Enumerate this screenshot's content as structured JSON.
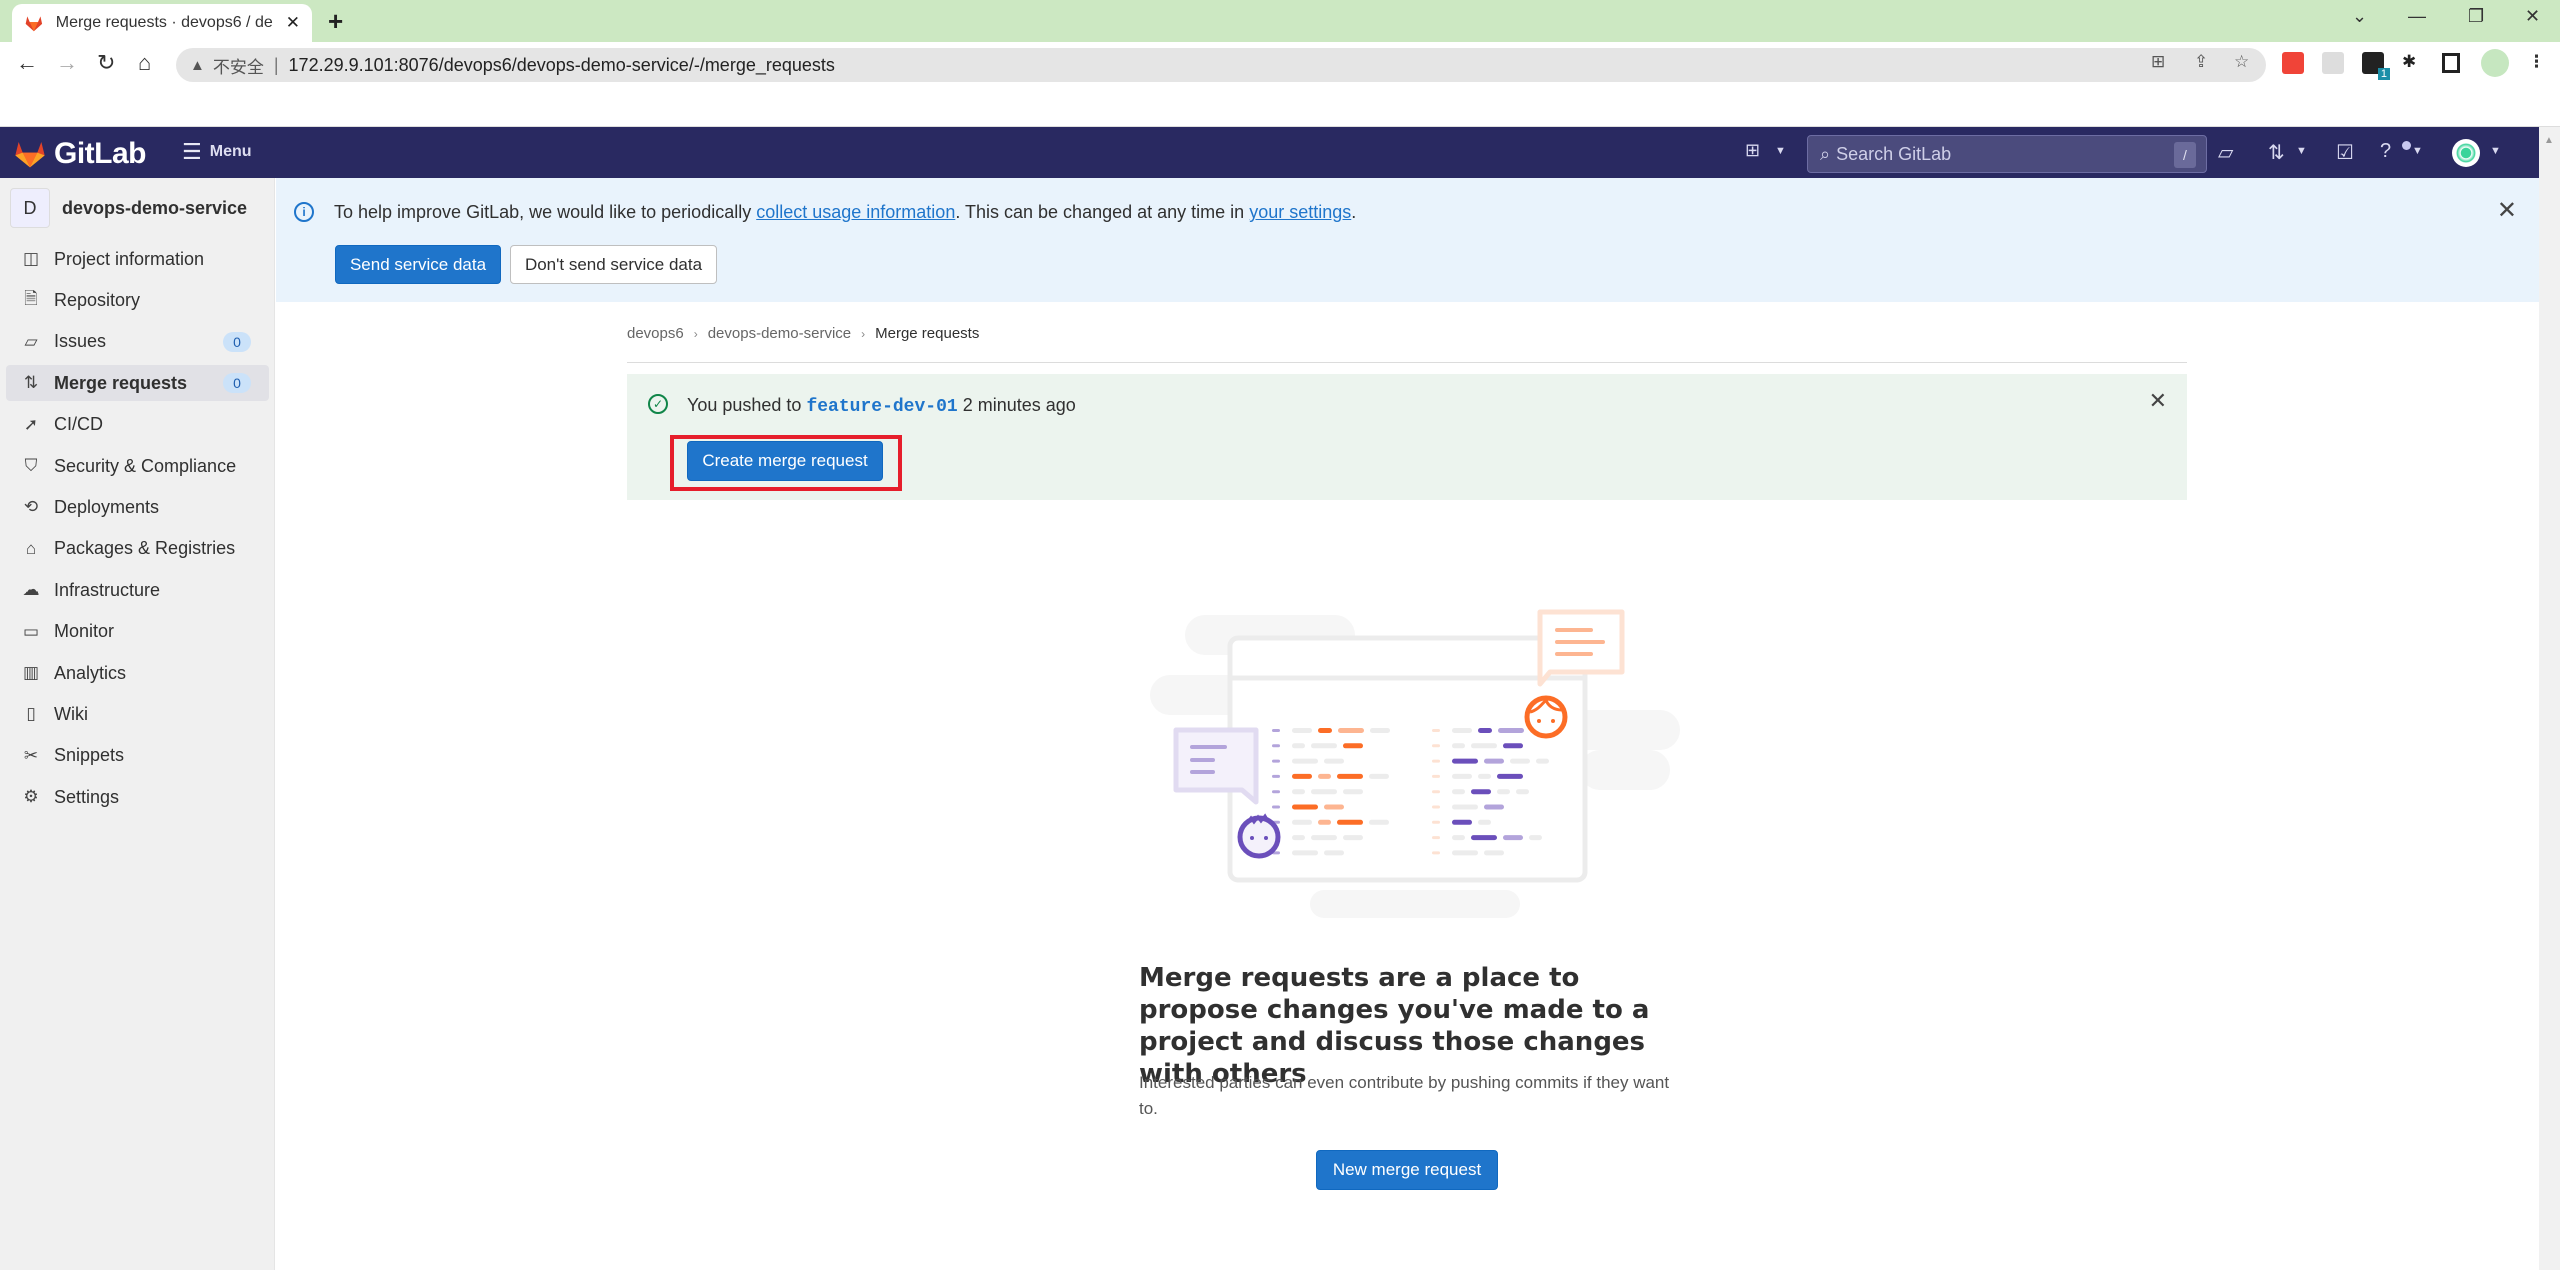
{
  "browser": {
    "tab_title": "Merge requests · devops6 / de",
    "security_label": "不安全",
    "url": "172.29.9.101:8076/devops6/devops-demo-service/-/merge_requests",
    "extension_badge": "1"
  },
  "header": {
    "brand": "GitLab",
    "menu_label": "Menu",
    "search_placeholder": "Search GitLab",
    "search_shortcut": "/"
  },
  "sidebar": {
    "project_initial": "D",
    "project_name": "devops-demo-service",
    "items": [
      {
        "label": "Project information",
        "icon": "project-icon"
      },
      {
        "label": "Repository",
        "icon": "document-icon"
      },
      {
        "label": "Issues",
        "icon": "issues-icon",
        "badge": "0"
      },
      {
        "label": "Merge requests",
        "icon": "merge-request-icon",
        "badge": "0",
        "active": true
      },
      {
        "label": "CI/CD",
        "icon": "rocket-icon"
      },
      {
        "label": "Security & Compliance",
        "icon": "shield-icon"
      },
      {
        "label": "Deployments",
        "icon": "deployments-icon"
      },
      {
        "label": "Packages & Registries",
        "icon": "package-icon"
      },
      {
        "label": "Infrastructure",
        "icon": "cloud-gear-icon"
      },
      {
        "label": "Monitor",
        "icon": "monitor-icon"
      },
      {
        "label": "Analytics",
        "icon": "chart-icon"
      },
      {
        "label": "Wiki",
        "icon": "book-icon"
      },
      {
        "label": "Snippets",
        "icon": "scissors-icon"
      },
      {
        "label": "Settings",
        "icon": "gear-icon"
      }
    ]
  },
  "banner": {
    "text_before": "To help improve GitLab, we would like to periodically ",
    "link1": "collect usage information",
    "text_middle": ". This can be changed at any time in ",
    "link2": "your settings",
    "text_after": ".",
    "send_button": "Send service data",
    "dont_send_button": "Don't send service data"
  },
  "breadcrumb": [
    "devops6",
    "devops-demo-service",
    "Merge requests"
  ],
  "push_alert": {
    "text_before": "You pushed to ",
    "branch": "feature-dev-01",
    "text_after": " 2 minutes ago",
    "button": "Create merge request"
  },
  "empty_state": {
    "title": "Merge requests are a place to propose changes you've made to a project and discuss those changes with others",
    "description": "Interested parties can even contribute by pushing commits if they want to.",
    "button": "New merge request"
  },
  "colors": {
    "header_bg": "#292961",
    "primary": "#1f75cb",
    "highlight_box": "#e61e2b",
    "success": "#108548"
  }
}
